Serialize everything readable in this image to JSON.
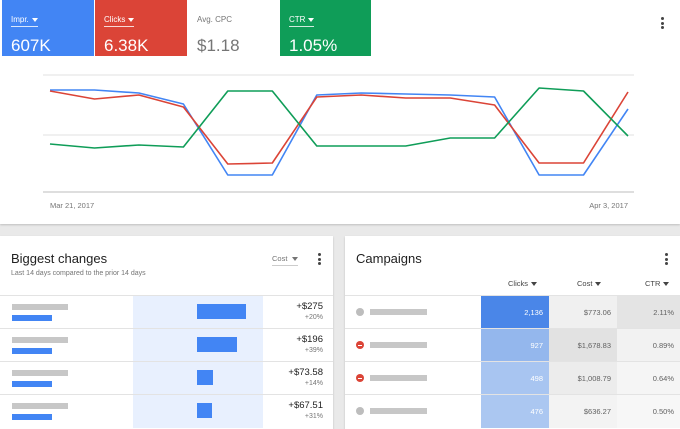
{
  "metrics": {
    "impr": {
      "label": "Impr.",
      "value": "607K"
    },
    "clicks": {
      "label": "Clicks",
      "value": "6.38K"
    },
    "cpc": {
      "label": "Avg. CPC",
      "value": "$1.18"
    },
    "ctr": {
      "label": "CTR",
      "value": "1.05%"
    }
  },
  "colors": {
    "impr": "#4285f4",
    "clicks": "#db4437",
    "ctr": "#0f9d58"
  },
  "chart_data": {
    "type": "line",
    "x_start_label": "Mar 21, 2017",
    "x_end_label": "Apr 3, 2017",
    "grid": true,
    "series": [
      {
        "key": "impr",
        "values": [
          0.94,
          0.94,
          0.91,
          0.8,
          0.09,
          0.09,
          0.89,
          0.91,
          0.9,
          0.89,
          0.87,
          0.09,
          0.09,
          0.75
        ]
      },
      {
        "key": "clicks",
        "values": [
          0.93,
          0.85,
          0.89,
          0.77,
          0.2,
          0.21,
          0.87,
          0.89,
          0.86,
          0.86,
          0.79,
          0.21,
          0.21,
          0.92
        ]
      },
      {
        "key": "ctr",
        "values": [
          0.4,
          0.36,
          0.39,
          0.37,
          0.93,
          0.93,
          0.38,
          0.38,
          0.38,
          0.46,
          0.46,
          0.96,
          0.93,
          0.48
        ]
      }
    ]
  },
  "biggest_changes": {
    "title": "Biggest changes",
    "subtitle": "Last 14 days compared to the prior 14 days",
    "metric_select": "Cost",
    "rows": [
      {
        "amount": "+$275",
        "pct": "+20%",
        "bar": 0.82
      },
      {
        "amount": "+$196",
        "pct": "+39%",
        "bar": 0.67
      },
      {
        "amount": "+$73.58",
        "pct": "+14%",
        "bar": 0.27
      },
      {
        "amount": "+$67.51",
        "pct": "+31%",
        "bar": 0.25
      }
    ]
  },
  "campaigns": {
    "title": "Campaigns",
    "columns": {
      "clicks": "Clicks",
      "cost": "Cost",
      "ctr": "CTR"
    },
    "rows": [
      {
        "status": "paused",
        "clicks": "2,136",
        "cost": "$773.06",
        "ctr": "2.11%",
        "clicks_color": "#4a86e8",
        "cost_color": "#f0f0f0",
        "ctr_color": "#e4e4e4"
      },
      {
        "status": "removed",
        "clicks": "927",
        "cost": "$1,678.83",
        "ctr": "0.89%",
        "clicks_color": "#94b7ed",
        "cost_color": "#e2e2e2",
        "ctr_color": "#f2f2f2"
      },
      {
        "status": "removed",
        "clicks": "498",
        "cost": "$1,008.79",
        "ctr": "0.64%",
        "clicks_color": "#a8c5f1",
        "cost_color": "#ececec",
        "ctr_color": "#f5f5f5"
      },
      {
        "status": "paused",
        "clicks": "476",
        "cost": "$636.27",
        "ctr": "0.50%",
        "clicks_color": "#abc7f1",
        "cost_color": "#f3f3f3",
        "ctr_color": "#f7f7f7"
      }
    ]
  }
}
